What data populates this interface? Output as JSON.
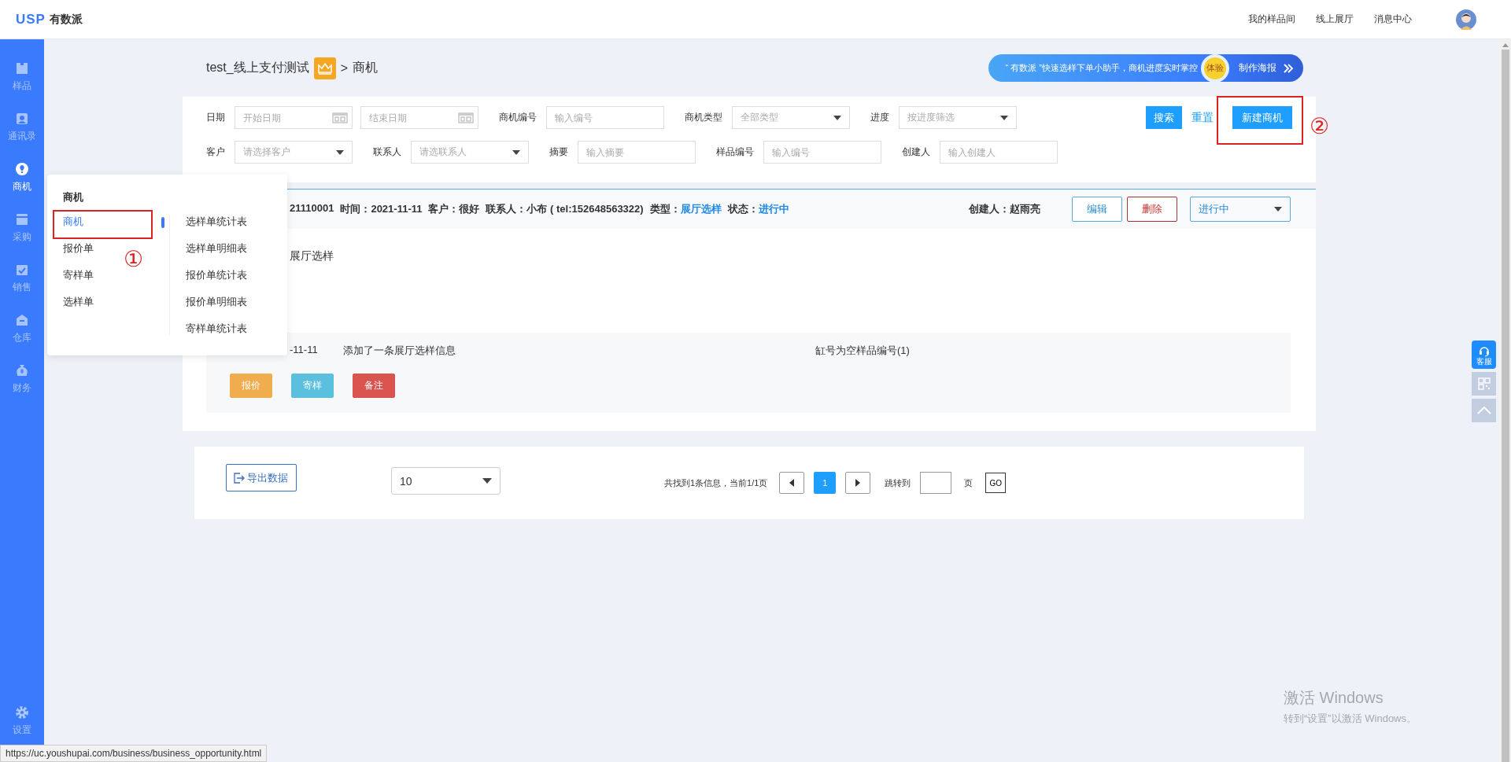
{
  "logo": {
    "mark": "USP",
    "name": "有数派"
  },
  "top_nav": [
    "我的样品间",
    "线上展厅",
    "消息中心"
  ],
  "sidebar": {
    "items": [
      {
        "label": "样品",
        "selected": false
      },
      {
        "label": "通讯录",
        "selected": false
      },
      {
        "label": "商机",
        "selected": true
      },
      {
        "label": "采购",
        "selected": false
      },
      {
        "label": "销售",
        "selected": false
      },
      {
        "label": "仓库",
        "selected": false
      },
      {
        "label": "财务",
        "selected": false
      }
    ],
    "footer": {
      "label": "设置"
    }
  },
  "breadcrumb": {
    "company": "test_线上支付测试",
    "separator": ">",
    "page": "商机"
  },
  "banner": {
    "text": "“ 有数派 ”快速选样下单小助手，商机进度实时掌控",
    "badge": "体验",
    "link": "制作海报"
  },
  "filters": {
    "rows": [
      [
        {
          "kind": "label",
          "text": "日期"
        },
        {
          "kind": "date",
          "placeholder": "开始日期"
        },
        {
          "kind": "date",
          "placeholder": "结束日期"
        },
        {
          "kind": "label",
          "text": "商机编号"
        },
        {
          "kind": "text",
          "placeholder": "输入编号"
        },
        {
          "kind": "label",
          "text": "商机类型"
        },
        {
          "kind": "select",
          "placeholder": "全部类型"
        },
        {
          "kind": "label",
          "text": "进度"
        },
        {
          "kind": "select",
          "placeholder": "按进度筛选"
        }
      ],
      [
        {
          "kind": "label",
          "text": "客户"
        },
        {
          "kind": "select",
          "placeholder": "请选择客户"
        },
        {
          "kind": "label",
          "text": "联系人"
        },
        {
          "kind": "select",
          "placeholder": "请选联系人"
        },
        {
          "kind": "label",
          "text": "摘要"
        },
        {
          "kind": "text",
          "placeholder": "输入摘要"
        },
        {
          "kind": "label",
          "text": "样品编号"
        },
        {
          "kind": "text",
          "placeholder": "输入编号"
        },
        {
          "kind": "label",
          "text": "创建人"
        },
        {
          "kind": "text",
          "placeholder": "输入创建人"
        }
      ]
    ],
    "search": "搜索",
    "reset": "重置",
    "create": "新建商机"
  },
  "opportunity": {
    "header_items": [
      {
        "value": "21110001",
        "highlight": false
      },
      {
        "label": "时间：",
        "value": "2021-11-11",
        "highlight": false
      },
      {
        "label": "客户：",
        "value": "很好",
        "highlight": false
      },
      {
        "label": "联系人：",
        "value": "小布 ( tel:152648563322)",
        "highlight": false
      },
      {
        "label": "类型：",
        "value": "展厅选样",
        "highlight": true
      },
      {
        "label": "状态：",
        "value": "进行中",
        "highlight": true
      }
    ],
    "creator": "创建人：赵雨亮",
    "buttons": [
      {
        "kind": "edit",
        "label": "编辑"
      },
      {
        "kind": "delete",
        "label": "删除"
      }
    ],
    "status_select": "进行中",
    "summary": "展厅选样",
    "log": {
      "date": "-11-11",
      "text": "添加了一条展厅选样信息",
      "note": "缸号为空样品编号(1)"
    },
    "actions": [
      {
        "label": "报价",
        "color": "#f0ad4e"
      },
      {
        "label": "寄样",
        "color": "#5bc0de"
      },
      {
        "label": "备注",
        "color": "#d9534f"
      }
    ]
  },
  "pagination": {
    "export": "导出数据",
    "page_size": "10",
    "info": "共找到1条信息，当前1/1页",
    "pages": [
      {
        "label": "1",
        "selected": true
      }
    ],
    "jump_label": "跳转到",
    "page_unit": "页",
    "go": "GO"
  },
  "menu": {
    "title": "商机",
    "items": [
      {
        "label": "商机",
        "selected": true
      },
      {
        "label": "报价单",
        "selected": false
      },
      {
        "label": "寄样单",
        "selected": false
      },
      {
        "label": "选样单",
        "selected": false
      }
    ],
    "reports": [
      "选样单统计表",
      "选样单明细表",
      "报价单统计表",
      "报价单明细表",
      "寄样单统计表"
    ]
  },
  "annotations": [
    "①",
    "②"
  ],
  "float_tools": {
    "service": "客服"
  },
  "status_url": "https://uc.youshupai.com/business/business_opportunity.html",
  "os_notice": {
    "title": "激活 Windows",
    "text": "转到“设置”以激活 Windows。"
  }
}
